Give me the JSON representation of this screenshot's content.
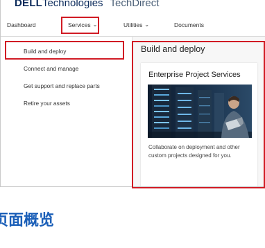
{
  "brand": {
    "dell": "DELL",
    "technologies": "Technologies",
    "product": "TechDirect"
  },
  "nav": {
    "items": [
      {
        "label": "Dashboard"
      },
      {
        "label": "Services"
      },
      {
        "label": "Utilities"
      },
      {
        "label": "Documents"
      }
    ]
  },
  "menu": {
    "items": [
      {
        "label": "Build and deploy"
      },
      {
        "label": "Connect and manage"
      },
      {
        "label": "Get support and replace parts"
      },
      {
        "label": "Retire your assets"
      }
    ]
  },
  "panel": {
    "title": "Build and deploy",
    "card": {
      "title": "Enterprise Project Services",
      "description": "Collaborate on deployment and other custom projects designed for you."
    }
  },
  "bottom": {
    "heading": "页面概览"
  },
  "colors": {
    "highlight_red": "#d11b24",
    "heading_blue": "#1b5fb8",
    "brand_navy": "#0b2a5b"
  }
}
